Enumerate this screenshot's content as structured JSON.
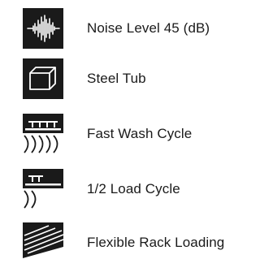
{
  "features": [
    {
      "label": "Noise Level 45 (dB)",
      "icon": "sound-wave-icon"
    },
    {
      "label": "Steel Tub",
      "icon": "tub-box-icon"
    },
    {
      "label": "Fast Wash Cycle",
      "icon": "fast-wash-racks-icon"
    },
    {
      "label": "1/2 Load Cycle",
      "icon": "half-load-rack-icon"
    },
    {
      "label": "Flexible Rack Loading",
      "icon": "rack-loading-icon"
    }
  ],
  "colors": {
    "icon_background": "#1a1a1a",
    "icon_foreground": "#ffffff",
    "text": "#1a1a1a"
  }
}
